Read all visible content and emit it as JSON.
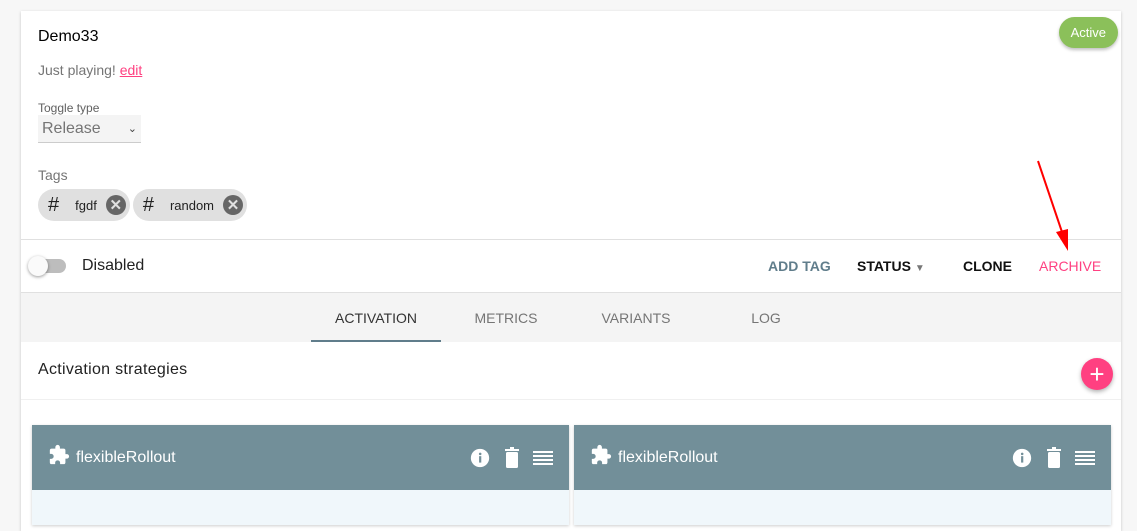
{
  "toggle": {
    "name": "Demo33",
    "status_badge": "Active",
    "description": "Just playing!",
    "edit_link": "edit",
    "toggle_type_label": "Toggle type",
    "toggle_type_value": "Release",
    "tags_label": "Tags",
    "tags": [
      {
        "label": "fgdf"
      },
      {
        "label": "random"
      }
    ]
  },
  "actions": {
    "enabled_label": "Disabled",
    "enabled": false,
    "add_tag": "ADD TAG",
    "status": "STATUS",
    "clone": "CLONE",
    "archive": "ARCHIVE"
  },
  "tabs": [
    {
      "label": "ACTIVATION",
      "active": true
    },
    {
      "label": "METRICS"
    },
    {
      "label": "VARIANTS"
    },
    {
      "label": "LOG"
    }
  ],
  "activation": {
    "title": "Activation strategies",
    "strategies": [
      {
        "name": "flexibleRollout"
      },
      {
        "name": "flexibleRollout"
      }
    ]
  },
  "colors": {
    "accent": "#ff4081",
    "active": "#8bc05a",
    "strategy_header": "#728f99",
    "annotation_arrow": "#ff0000"
  }
}
